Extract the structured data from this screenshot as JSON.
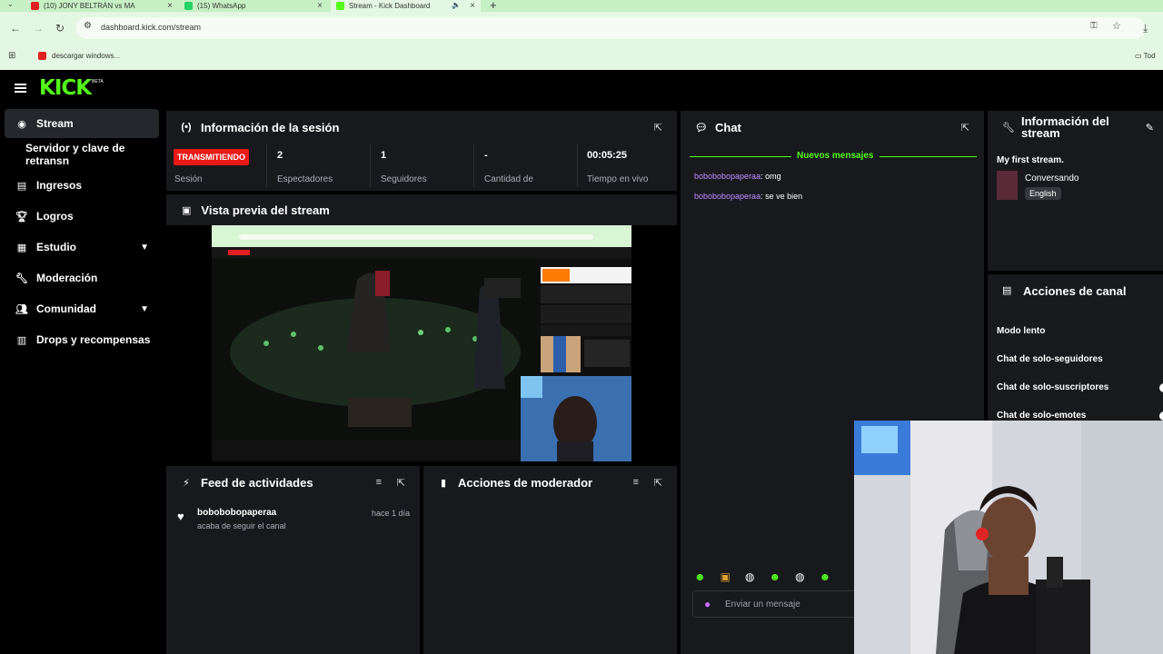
{
  "browser": {
    "tabs": [
      {
        "label": "(10) JONY BELTRÁN vs MA",
        "favicon_color": "#e02020"
      },
      {
        "label": "(15) WhatsApp",
        "favicon_color": "#25d366"
      },
      {
        "label": "Stream - Kick Dashboard",
        "favicon_color": "#53fc18"
      }
    ],
    "url": "dashboard.kick.com/stream",
    "bookmark": "descargar windows...",
    "bookmark_right": "Tod"
  },
  "brand": {
    "logo": "KICK",
    "badge": "BETA",
    "accent": "#53fc18"
  },
  "sidebar": {
    "items": [
      {
        "label": "Stream",
        "icon": "radio-icon",
        "active": true
      },
      {
        "label": "Servidor y clave de retransn",
        "icon": "",
        "active": false
      },
      {
        "label": "Ingresos",
        "icon": "dollar-icon",
        "active": false
      },
      {
        "label": "Logros",
        "icon": "trophy-icon",
        "active": false
      },
      {
        "label": "Estudio",
        "icon": "grid-icon",
        "active": false
      },
      {
        "label": "Moderación",
        "icon": "wrench-icon",
        "active": false
      },
      {
        "label": "Comunidad",
        "icon": "users-icon",
        "active": false
      },
      {
        "label": "Drops y recompensas",
        "icon": "chart-icon",
        "active": false
      }
    ]
  },
  "session": {
    "title": "Información de la sesión",
    "status": "TRANSMITIENDO",
    "status_label": "Sesión",
    "stats": [
      {
        "value": "2",
        "label": "Espectadores"
      },
      {
        "value": "1",
        "label": "Seguidores"
      },
      {
        "value": "-",
        "label": "Cantidad de"
      },
      {
        "value": "00:05:25",
        "label": "Tiempo en vivo"
      }
    ]
  },
  "preview": {
    "title": "Vista previa del stream"
  },
  "chat": {
    "title": "Chat",
    "new_messages": "Nuevos mensajes",
    "messages": [
      {
        "user": "bobobobopaperaa",
        "text": "omg"
      },
      {
        "user": "bobobobopaperaa",
        "text": "se ve bien"
      }
    ],
    "placeholder": "Enviar un mensaje"
  },
  "stream_info": {
    "title": "Información del stream",
    "stream_title": "My first stream.",
    "category": "Conversando",
    "language": "English"
  },
  "channel_actions": {
    "title": "Acciones de canal",
    "items": [
      "Modo lento",
      "Chat de solo-seguidores",
      "Chat de solo-suscriptores",
      "Chat de solo-emotes"
    ]
  },
  "activity": {
    "title": "Feed de actividades",
    "items": [
      {
        "user": "bobobobopaperaa",
        "action": "acaba de seguir el canal",
        "time": "hace 1 día"
      }
    ]
  },
  "mod_actions": {
    "title": "Acciones de moderador"
  }
}
